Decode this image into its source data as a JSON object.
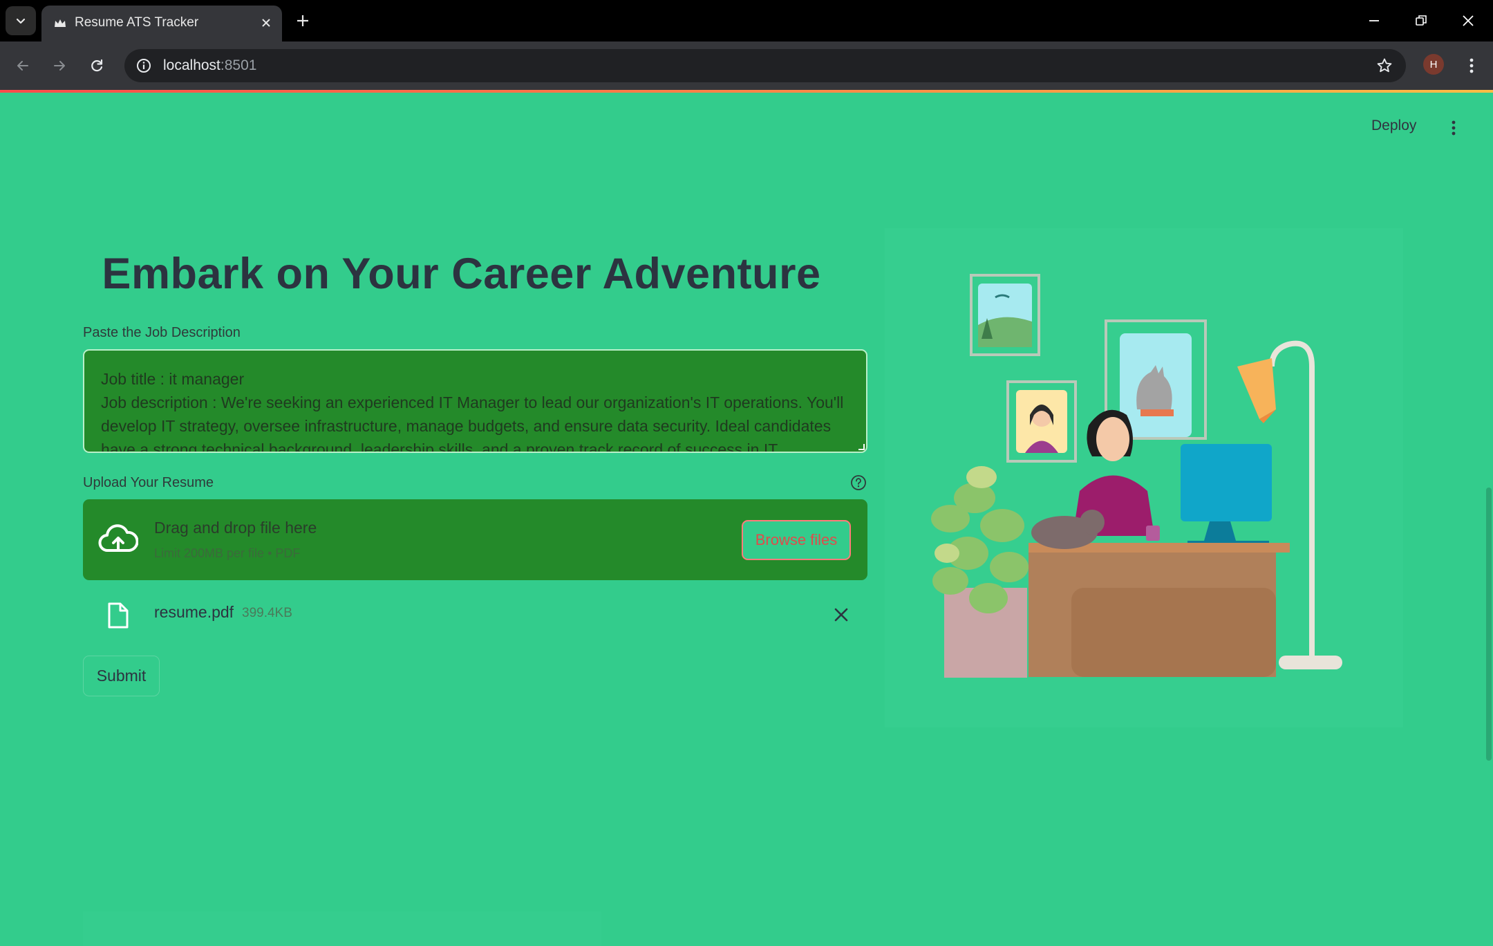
{
  "browser": {
    "tab_title": "Resume ATS Tracker",
    "url_host": "localhost",
    "url_port": ":8501",
    "profile_initial": "H"
  },
  "app": {
    "deploy_label": "Deploy",
    "title": "Embark on Your Career Adventure",
    "job_description": {
      "label": "Paste the Job Description",
      "value": "Job title : it manager\nJob description : We're seeking an experienced IT Manager to lead our organization's IT operations. You'll develop IT strategy, oversee infrastructure, manage budgets, and ensure data security. Ideal candidates have a strong technical background, leadership skills, and a proven track record of success in IT"
    },
    "upload": {
      "label": "Upload Your Resume",
      "drop_text": "Drag and drop file here",
      "limit_text": "Limit 200MB per file • PDF",
      "browse_label": "Browse files",
      "file_name": "resume.pdf",
      "file_size": "399.4KB"
    },
    "submit_label": "Submit"
  },
  "colors": {
    "page_bg": "#33cc8c",
    "input_bg": "#248a2a",
    "primary": "#ff4b4b",
    "text": "#31333f"
  },
  "icons": [
    "tab-list-icon",
    "crown-favicon-icon",
    "close-tab-icon",
    "new-tab-icon",
    "minimize-icon",
    "restore-icon",
    "close-window-icon",
    "back-icon",
    "forward-icon",
    "reload-icon",
    "site-info-icon",
    "bookmark-star-icon",
    "chrome-menu-icon",
    "app-menu-icon",
    "help-icon",
    "cloud-upload-icon",
    "file-icon",
    "remove-file-icon"
  ]
}
